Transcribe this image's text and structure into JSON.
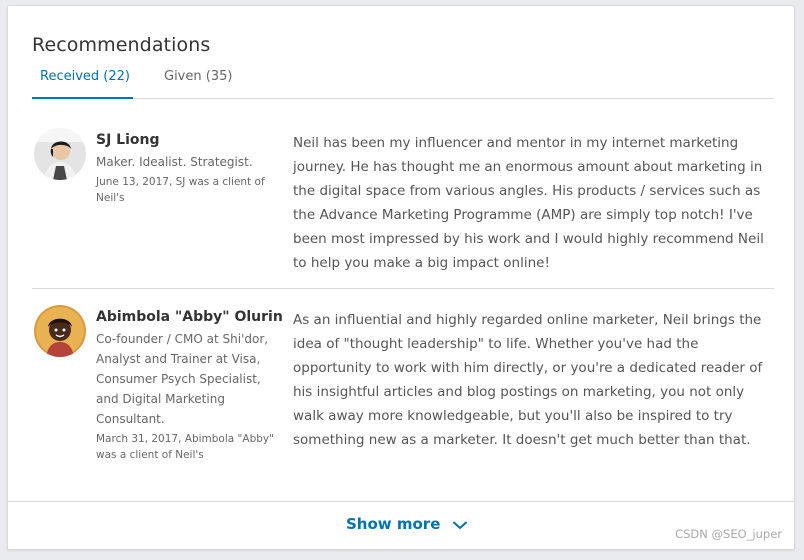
{
  "section": {
    "title": "Recommendations",
    "tabs": [
      {
        "label": "Received (22)",
        "active": true
      },
      {
        "label": "Given (35)",
        "active": false
      }
    ]
  },
  "recommendations": [
    {
      "name": "SJ Liong",
      "headline": "Maker. Idealist. Strategist.",
      "meta": "June 13, 2017, SJ was a client of Neil's",
      "avatar_icon": "person-photo",
      "text": "Neil has been my influencer and mentor in my internet marketing journey. He has thought me an enormous amount about marketing in the digital space from various angles. His products / services such as the Advance Marketing Programme (AMP) are simply top notch! I've been most impressed by his work and I would highly recommend Neil to help you make a big impact online!"
    },
    {
      "name": "Abimbola \"Abby\" Olurin",
      "headline": "Co-founder / CMO at Shi'dor, Analyst and Trainer at Visa, Consumer Psych Specialist, and Digital Marketing Consultant.",
      "meta": "March 31, 2017, Abimbola \"Abby\" was a client of Neil's",
      "avatar_icon": "person-photo",
      "text": "As an influential and highly regarded online marketer, Neil brings the idea of \"thought leadership\" to life. Whether you've had the opportunity to work with him directly, or you're a dedicated reader of his insightful articles and blog postings on marketing, you not only walk away more knowledgeable, but you'll also be inspired to try something new as a marketer. It doesn't get much better than that."
    }
  ],
  "footer": {
    "show_more_label": "Show more",
    "chevron_icon": "chevron-down-icon"
  },
  "watermark": "CSDN @SEO_juper",
  "colors": {
    "accent": "#0073b1",
    "text_primary": "#333333",
    "text_secondary": "#666666",
    "divider": "#d9d9d9"
  }
}
